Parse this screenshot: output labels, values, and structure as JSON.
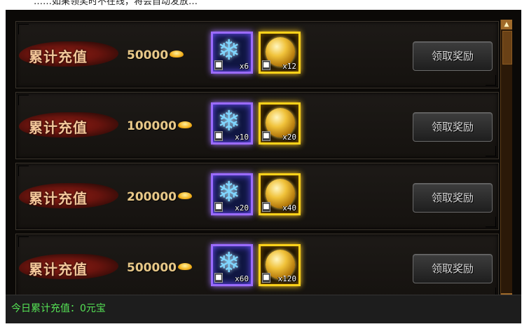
{
  "header_fragment": "……如果领奖时不在线，将会自动发放…",
  "rows": [
    {
      "label": "累计充值",
      "amount": "50000",
      "snow_count": "x6",
      "orb_count": "x12",
      "button": "领取奖励"
    },
    {
      "label": "累计充值",
      "amount": "100000",
      "snow_count": "x10",
      "orb_count": "x20",
      "button": "领取奖励"
    },
    {
      "label": "累计充值",
      "amount": "200000",
      "snow_count": "x20",
      "orb_count": "x40",
      "button": "领取奖励"
    },
    {
      "label": "累计充值",
      "amount": "500000",
      "snow_count": "x60",
      "orb_count": "x120",
      "button": "领取奖励"
    }
  ],
  "icons": {
    "currency": "gold-ingot-icon",
    "item_1": "snowflake-icon",
    "item_2": "gold-orb-icon",
    "lock": "lock-icon"
  },
  "footer": {
    "today_recharge": "今日累计充值：0元宝"
  },
  "colors": {
    "snow_frame": "#9b6bff",
    "gold_frame": "#ffd21a",
    "footer_text": "#55e255",
    "label_text": "#f2c79a"
  }
}
